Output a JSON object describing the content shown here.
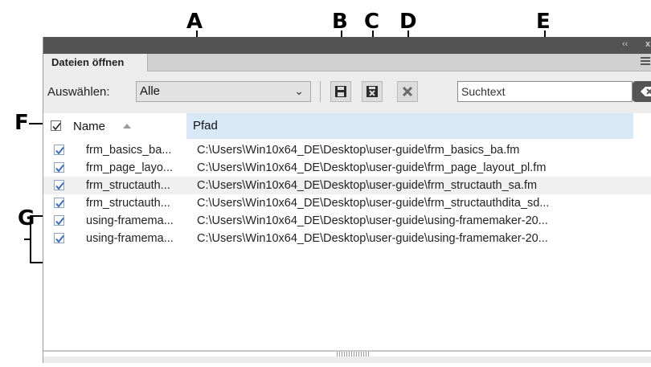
{
  "callouts": {
    "a": "A",
    "b": "B",
    "c": "C",
    "d": "D",
    "e": "E",
    "f": "F",
    "g": "G"
  },
  "titlebar": {
    "collapse_icon": "double-chevron-left-icon",
    "collapse_glyph": "‹‹",
    "close_glyph": "x"
  },
  "panel": {
    "tab_label": "Dateien öffnen",
    "menu_icon": "hamburger-menu-icon"
  },
  "toolbar": {
    "select_label": "Auswählen:",
    "select_value": "Alle",
    "save_icon": "save-icon",
    "save_close_icon": "save-and-close-icon",
    "close_icon": "close-icon",
    "search_placeholder": "Suchtext",
    "clear_icon": "clear-search-icon"
  },
  "list": {
    "header_name": "Name",
    "header_path": "Pfad",
    "select_all_checked": true,
    "rows": [
      {
        "name": "frm_basics_ba...",
        "path": "C:\\Users\\Win10x64_DE\\Desktop\\user-guide\\frm_basics_ba.fm",
        "checked": true
      },
      {
        "name": "frm_page_layo...",
        "path": "C:\\Users\\Win10x64_DE\\Desktop\\user-guide\\frm_page_layout_pl.fm",
        "checked": true
      },
      {
        "name": "frm_structauth...",
        "path": "C:\\Users\\Win10x64_DE\\Desktop\\user-guide\\frm_structauth_sa.fm",
        "checked": true
      },
      {
        "name": "frm_structauth...",
        "path": "C:\\Users\\Win10x64_DE\\Desktop\\user-guide\\frm_structauthdita_sd...",
        "checked": true
      },
      {
        "name": "using-framema...",
        "path": "C:\\Users\\Win10x64_DE\\Desktop\\user-guide\\using-framemaker-20...",
        "checked": true
      },
      {
        "name": "using-framema...",
        "path": "C:\\Users\\Win10x64_DE\\Desktop\\user-guide\\using-framemaker-20...",
        "checked": true
      }
    ]
  },
  "colors": {
    "titlebar": "#535353",
    "header_highlight": "#d9e8f7",
    "checkbox_check": "#3a6fc0"
  }
}
